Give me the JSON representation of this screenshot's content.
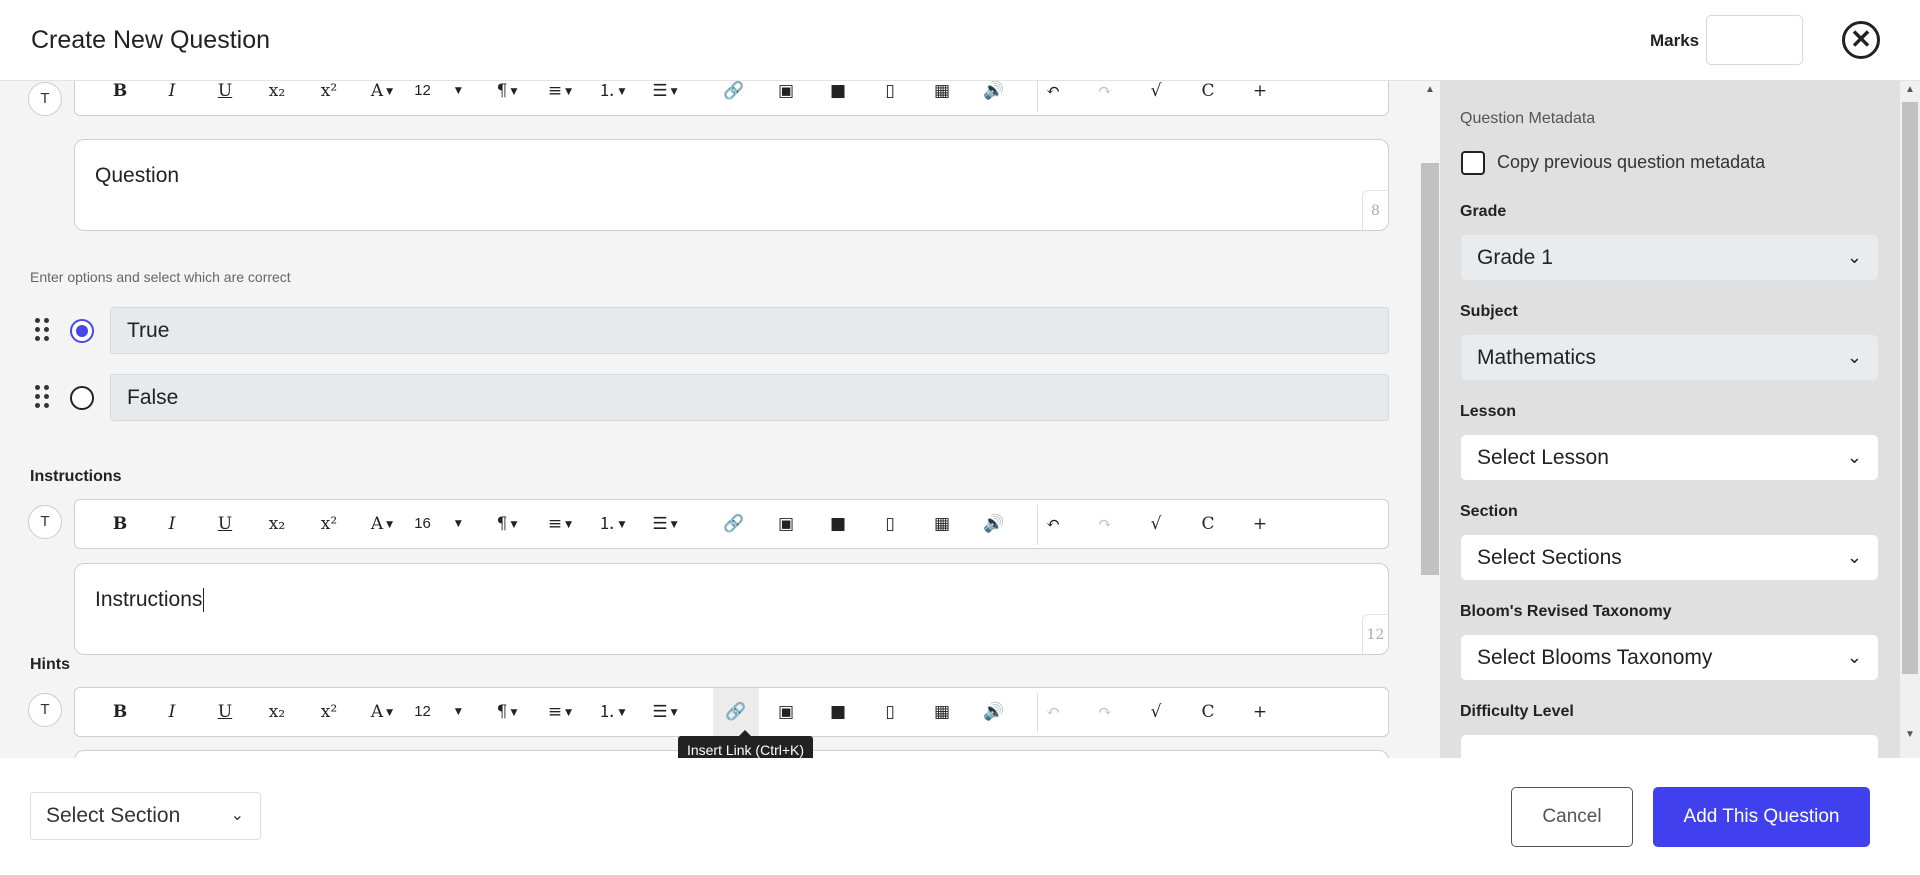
{
  "header": {
    "title": "Create New Question",
    "marks_label": "Marks",
    "marks_value": "",
    "close_symbol": "✕"
  },
  "toolbar_icons": {
    "bold": "B",
    "italic": "I",
    "underline": "U",
    "subscript": "x₂",
    "superscript": "x²",
    "font_color": "A",
    "paragraph": "¶",
    "align": "≡",
    "ordered_list": "⒈",
    "unordered_list": "☰",
    "link": "🔗",
    "image": "▣",
    "video": "■",
    "file": "▯",
    "table": "▦",
    "audio": "🔊",
    "undo": "↶",
    "redo": "↷",
    "sqrt": "√",
    "chem": "C",
    "more": "+",
    "insert_link_tip": "Insert Link (Ctrl+K)"
  },
  "question": {
    "toolbar_font_size": "12",
    "text": "Question",
    "char_count": "8"
  },
  "options": {
    "helper": "Enter options and select which are correct",
    "items": [
      {
        "label": "True",
        "selected": true
      },
      {
        "label": "False",
        "selected": false
      }
    ]
  },
  "instructions": {
    "label": "Instructions",
    "toolbar_font_size": "16",
    "text": "Instructions",
    "char_count": "12"
  },
  "hints": {
    "label": "Hints",
    "toolbar_font_size": "12"
  },
  "tooltip": "Insert Link (Ctrl+K)",
  "sidebar": {
    "title": "Question Metadata",
    "copy_label": "Copy previous question metadata",
    "grade": {
      "label": "Grade",
      "value": "Grade 1"
    },
    "subject": {
      "label": "Subject",
      "value": "Mathematics"
    },
    "lesson": {
      "label": "Lesson",
      "value": "Select Lesson"
    },
    "section": {
      "label": "Section",
      "value": "Select Sections"
    },
    "blooms": {
      "label": "Bloom's Revised Taxonomy",
      "value": "Select Blooms Taxonomy"
    },
    "difficulty": {
      "label": "Difficulty Level",
      "value": ""
    }
  },
  "footer": {
    "section_select": "Select Section",
    "cancel_label": "Cancel",
    "add_label": "Add This Question"
  },
  "icons": {
    "chevron_down": "⌄",
    "tooltip_caret": "▾"
  },
  "colors": {
    "accent": "#4040ef",
    "radio_selected": "#4747e6",
    "sidebar_bg": "#e0e0e0",
    "main_bg": "#f4f4f4"
  }
}
